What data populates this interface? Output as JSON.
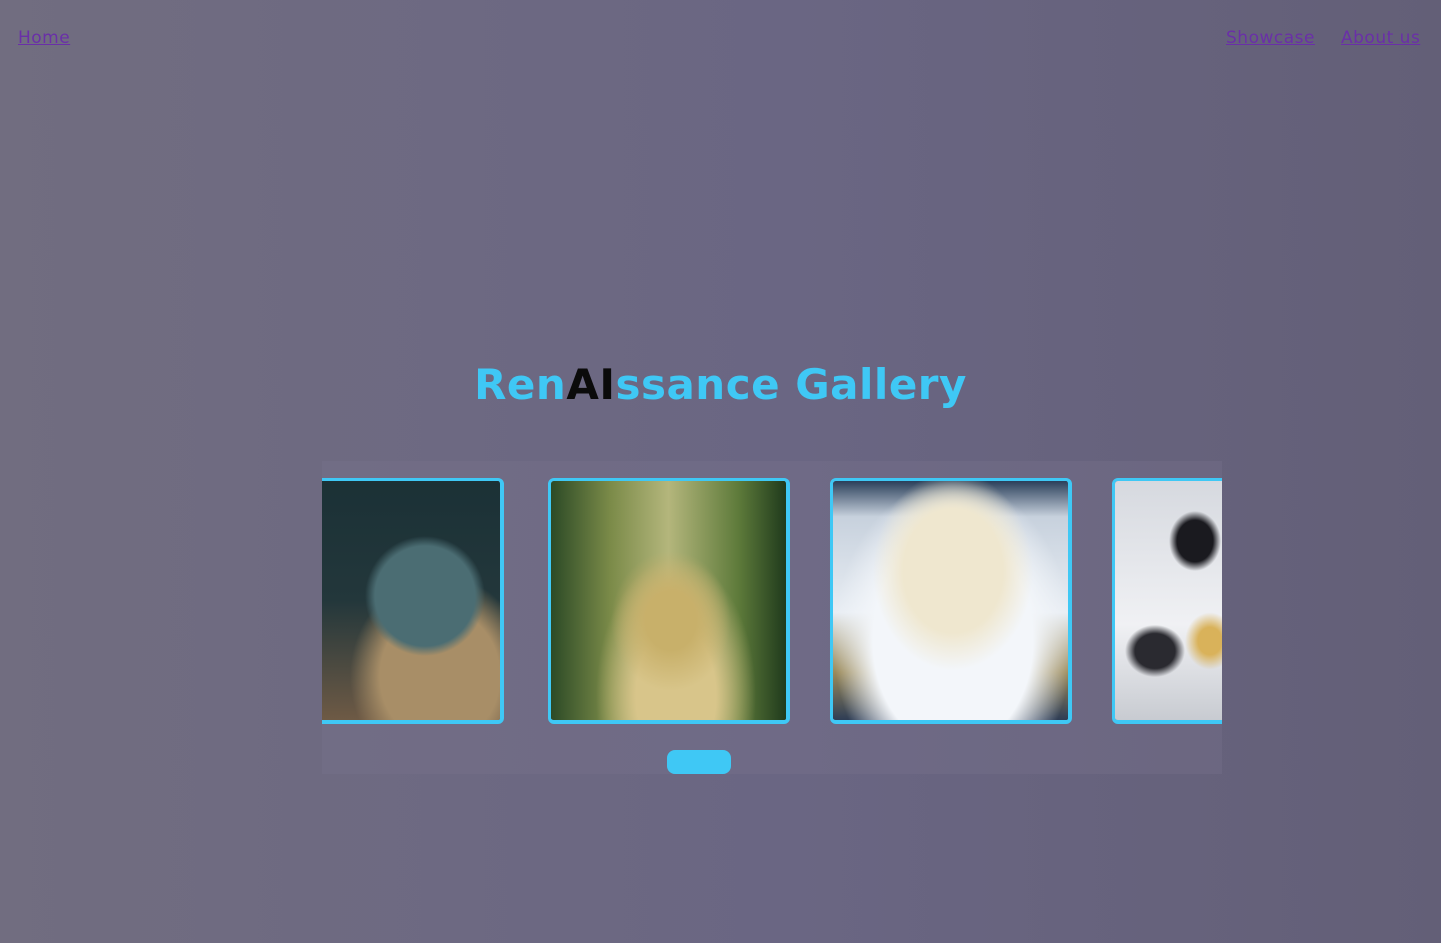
{
  "nav": {
    "home_label": "Home",
    "showcase_label": "Showcase",
    "about_label": "About us",
    "link_color": "#6a2fa8"
  },
  "hero": {
    "title_part1": "Ren",
    "title_highlight": "AI",
    "title_part2": "ssance Gallery",
    "accent_color": "#3fc8f5",
    "highlight_color": "#0b0b0b"
  },
  "gallery": {
    "cards": [
      {
        "subject": "skull-with-roses"
      },
      {
        "subject": "lioness-in-jungle-stream"
      },
      {
        "subject": "polar-bear-sleeping-on-ice"
      },
      {
        "subject": "penguins-in-snow"
      }
    ]
  }
}
